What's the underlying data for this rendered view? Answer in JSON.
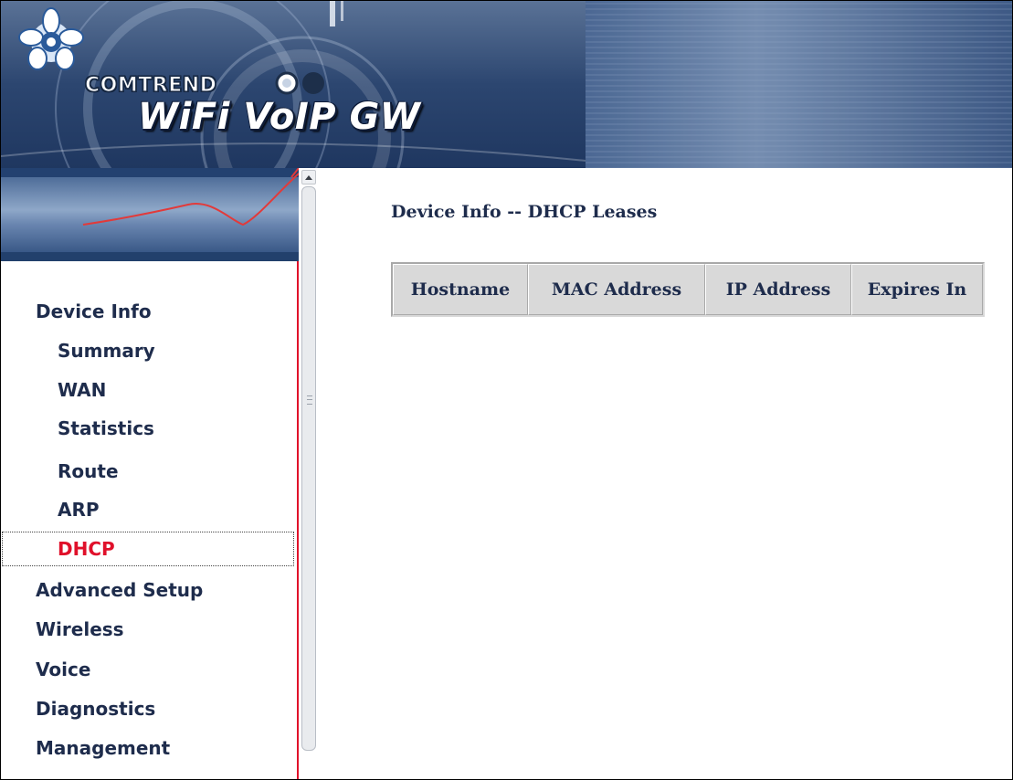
{
  "header": {
    "brand": "COMTREND",
    "product": "WiFi VoIP GW"
  },
  "sidebar": {
    "items": [
      {
        "label": "Device Info",
        "level": "top",
        "active": false
      },
      {
        "label": "Summary",
        "level": "sub",
        "active": false
      },
      {
        "label": "WAN",
        "level": "sub",
        "active": false
      },
      {
        "label": "Statistics",
        "level": "sub",
        "active": false
      },
      {
        "label": "Route",
        "level": "sub",
        "active": false
      },
      {
        "label": "ARP",
        "level": "sub",
        "active": false
      },
      {
        "label": "DHCP",
        "level": "sub",
        "active": true
      },
      {
        "label": "Advanced Setup",
        "level": "top",
        "active": false
      },
      {
        "label": "Wireless",
        "level": "top",
        "active": false
      },
      {
        "label": "Voice",
        "level": "top",
        "active": false
      },
      {
        "label": "Diagnostics",
        "level": "top",
        "active": false
      },
      {
        "label": "Management",
        "level": "top",
        "active": false
      }
    ]
  },
  "main": {
    "title": "Device Info -- DHCP Leases",
    "table": {
      "columns": [
        "Hostname",
        "MAC Address",
        "IP Address",
        "Expires In"
      ],
      "rows": []
    }
  },
  "colors": {
    "accent": "#e0102a",
    "text": "#1e2c4c",
    "banner": "#2b4a78"
  }
}
